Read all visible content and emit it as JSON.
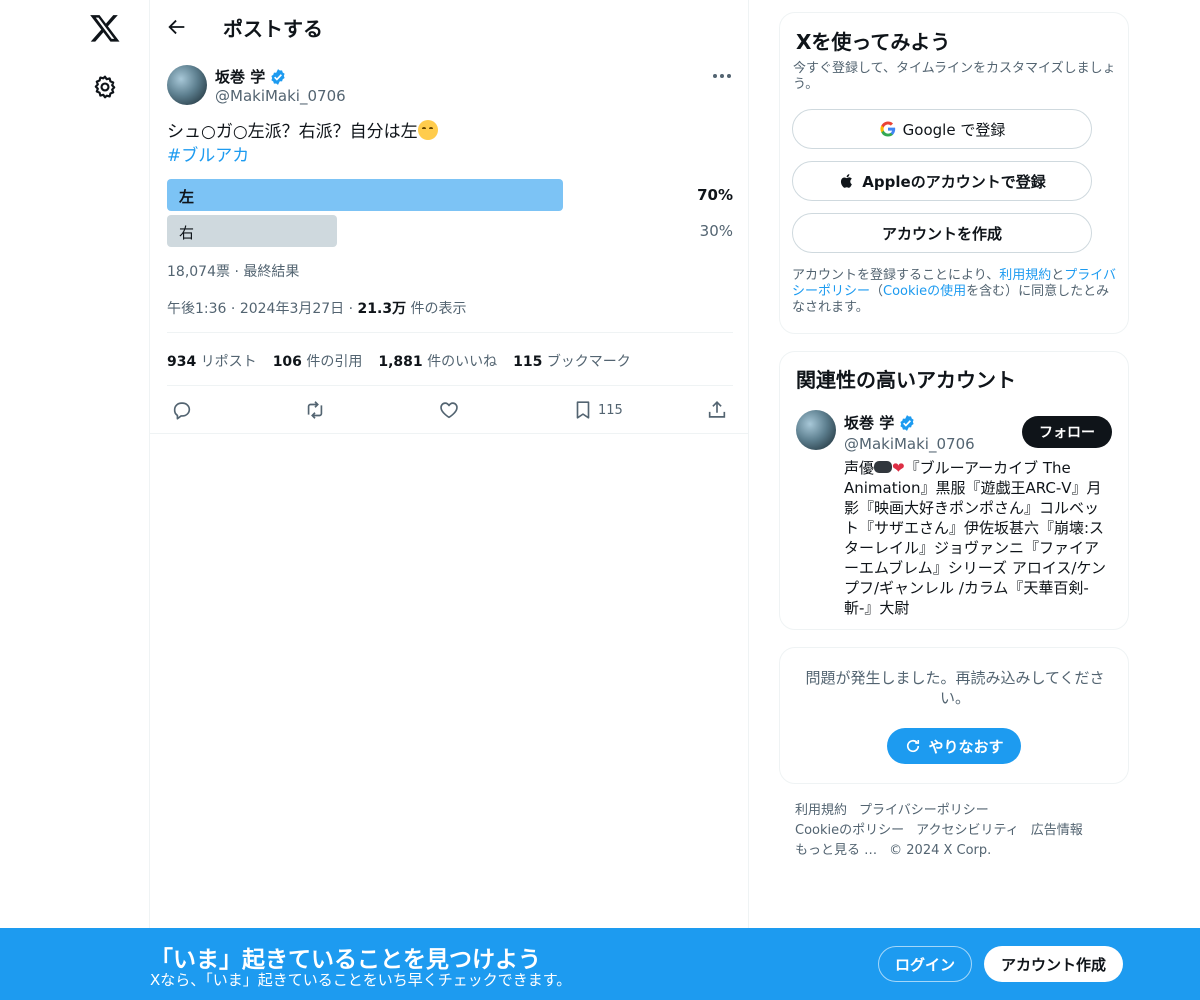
{
  "header": {
    "title": "ポストする"
  },
  "post": {
    "author_name": "坂巻 学",
    "author_handle": "@MakiMaki_0706",
    "text": "シュ○ガ○左派？右派？自分は左",
    "hashtag": "#ブルアカ",
    "poll": {
      "options": [
        {
          "label": "左",
          "percent_text": "70%",
          "percent": 70,
          "winner": true
        },
        {
          "label": "右",
          "percent_text": "30%",
          "percent": 30,
          "winner": false
        }
      ],
      "votes": "18,074票",
      "status": "最終結果"
    },
    "time": "午後1:36",
    "date": "2024年3月27日",
    "views_count": "21.3万",
    "views_label": "件の表示",
    "stats": {
      "reposts_count": "934",
      "reposts_label": "リポスト",
      "quotes_count": "106",
      "quotes_label": "件の引用",
      "likes_count": "1,881",
      "likes_label": "件のいいね",
      "bookmarks_count": "115",
      "bookmarks_label": "ブックマーク"
    },
    "bookmark_action_count": "115"
  },
  "signup": {
    "title": "Xを使ってみよう",
    "description": "今すぐ登録して、タイムラインをカスタマイズしましょう。",
    "google_label": "Google で登録",
    "apple_label": "Appleのアカウントで登録",
    "create_label": "アカウントを作成",
    "terms_prefix": "アカウントを登録することにより、",
    "terms_link": "利用規約",
    "terms_and": "と",
    "privacy_link": "プライバシーポリシー",
    "terms_paren_open": "（",
    "cookie_link": "Cookieの使用",
    "terms_suffix": "を含む）に同意したとみなされます。"
  },
  "related": {
    "title": "関連性の高いアカウント",
    "name": "坂巻 学",
    "handle": "@MakiMaki_0706",
    "follow_label": "フォロー",
    "bio_prefix": "声優",
    "bio_heart": "❤",
    "bio_rest": "『ブルーアーカイブ The Animation』黒服『遊戯王ARC-Ⅴ』月影『映画大好きポンポさん』コルベット『サザエさん』伊佐坂甚六『崩壊:スターレイル』ジョヴァンニ『ファイアーエムブレム』シリーズ アロイス/ケンプフ/ギャンレル /カラム『天華百剣-斬-』大尉"
  },
  "error": {
    "message": "問題が発生しました。再読み込みしてください。",
    "retry_label": "やりなおす"
  },
  "footer": {
    "links": [
      "利用規約",
      "プライバシーポリシー",
      "Cookieのポリシー",
      "アクセシビリティ",
      "広告情報",
      "もっと見る …",
      "© 2024 X Corp."
    ]
  },
  "banner": {
    "title": "「いま」起きていることを見つけよう",
    "subtitle": "Xなら、「いま」起きていることをいち早くチェックできます。",
    "login_label": "ログイン",
    "signup_label": "アカウント作成"
  },
  "colors": {
    "accent": "#1d9bf0",
    "poll_winner": "#7cc3f5",
    "poll_loser": "#cfd9de",
    "text": "#0f1419",
    "muted": "#536471"
  },
  "icons": {
    "logo": "x-logo-icon",
    "settings": "gear-icon",
    "back": "arrow-left-icon",
    "more": "more-horizontal-icon",
    "reply": "reply-icon",
    "repost": "repost-icon",
    "like": "heart-icon",
    "bookmark": "bookmark-icon",
    "share": "share-icon",
    "verified": "verified-badge-icon",
    "google": "google-icon",
    "apple": "apple-icon",
    "retry": "refresh-icon"
  }
}
